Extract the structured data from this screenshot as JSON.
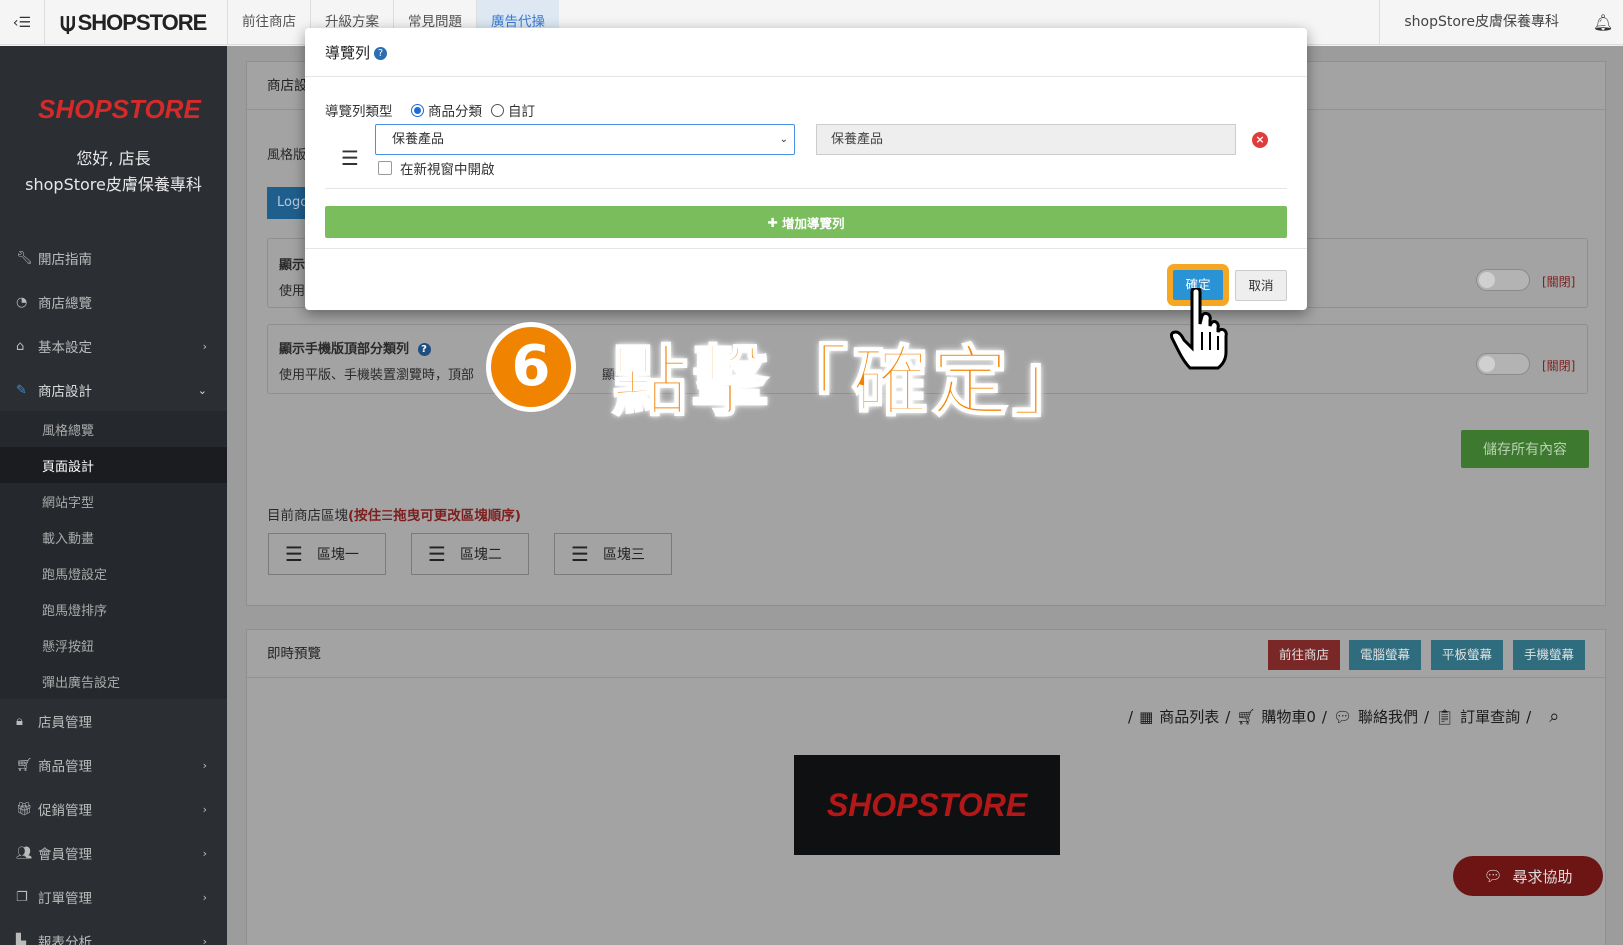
{
  "topbar": {
    "brand": "SHOPSTORE",
    "nav": [
      "前往商店",
      "升級方案",
      "常見問題",
      "廣告代操"
    ],
    "shop_name": "shopStore皮膚保養專科"
  },
  "sidebar": {
    "logo": "SHOPSTORE",
    "greeting": "您好, 店長",
    "shop_name": "shopStore皮膚保養專科",
    "items": [
      {
        "label": "開店指南",
        "icon": "wrench-icon"
      },
      {
        "label": "商店總覽",
        "icon": "dashboard-icon"
      },
      {
        "label": "基本設定",
        "icon": "bank-icon"
      },
      {
        "label": "商店設計",
        "icon": "brush-icon"
      },
      {
        "label": "店員管理",
        "icon": "lock-icon"
      },
      {
        "label": "商品管理",
        "icon": "cart-icon"
      },
      {
        "label": "促銷管理",
        "icon": "gift-icon"
      },
      {
        "label": "會員管理",
        "icon": "users-icon"
      },
      {
        "label": "訂單管理",
        "icon": "copy-icon"
      },
      {
        "label": "報表分析",
        "icon": "bar-chart-icon"
      }
    ],
    "sub_items": [
      "風格總覽",
      "頁面設計",
      "網站字型",
      "載入動畫",
      "跑馬燈設定",
      "跑馬燈排序",
      "懸浮按鈕",
      "彈出廣告設定"
    ]
  },
  "main": {
    "panel_title": "商店設",
    "style_label": "風格版",
    "logo_button": "Logo",
    "row1_title": "顯示",
    "row1_desc": "使用",
    "row2_title": "顯示手機版頂部分類列",
    "row2_desc": "使用平版、手機裝置瀏覽時，頂部",
    "row2_desc_tail": "顯示可",
    "off_label": "[關閉]",
    "save_button": "儲存所有內容",
    "blocks_title": "目前商店區塊",
    "blocks_hint": "(按住☰拖曳可更改區塊順序)",
    "blocks": [
      "區塊一",
      "區塊二",
      "區塊三"
    ]
  },
  "preview": {
    "title": "即時預覽",
    "buttons": [
      {
        "label": "前往商店",
        "color": "#7a2727"
      },
      {
        "label": "電腦螢幕",
        "color": "#2f6c7e"
      },
      {
        "label": "平板螢幕",
        "color": "#2f6c7e"
      },
      {
        "label": "手機螢幕",
        "color": "#2f6c7e"
      }
    ],
    "nav": [
      "商品列表",
      "購物車0",
      "聯絡我們",
      "訂單查詢"
    ],
    "logo": "SHOPSTORE"
  },
  "modal": {
    "title": "導覽列",
    "type_label": "導覽列類型",
    "radio_category": "商品分類",
    "radio_custom": "自訂",
    "select_value": "保養產品",
    "name_value": "保養產品",
    "new_window_label": "在新視窗中開啟",
    "add_button": "增加導覽列",
    "confirm_button": "確定",
    "cancel_button": "取消"
  },
  "annotation": {
    "step_number": "6",
    "text": "點擊「確定」"
  },
  "help_button": "尋求協助"
}
